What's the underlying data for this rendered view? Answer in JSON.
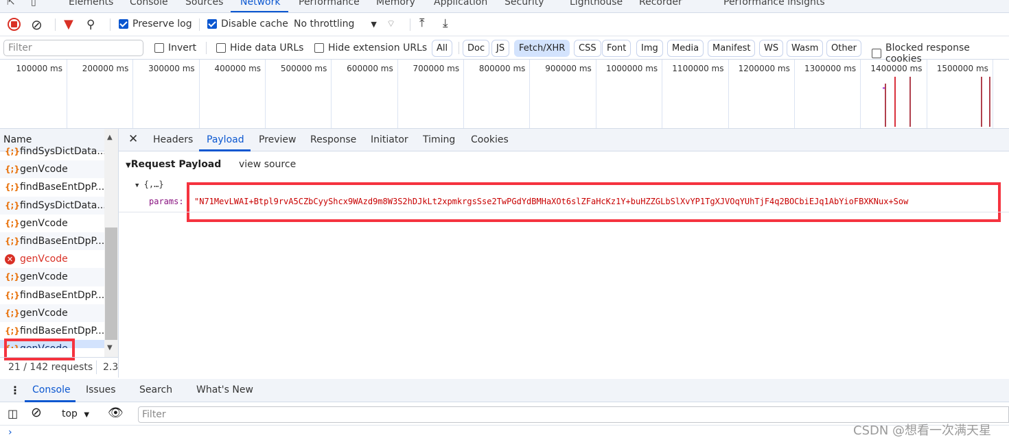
{
  "top_tabs": [
    "Elements",
    "Console",
    "Sources",
    "Network",
    "Performance",
    "Memory",
    "Application",
    "Security",
    "Lighthouse",
    "Recorder",
    "Performance insights"
  ],
  "active_top_tab": "Network",
  "toolbar": {
    "preserve_log": "Preserve log",
    "preserve_log_checked": true,
    "disable_cache": "Disable cache",
    "disable_cache_checked": true,
    "throttling": "No throttling"
  },
  "filter": {
    "placeholder": "Filter",
    "invert": "Invert",
    "hide_data_urls": "Hide data URLs",
    "hide_extension_urls": "Hide extension URLs",
    "types": [
      "All",
      "Doc",
      "JS",
      "Fetch/XHR",
      "CSS",
      "Font",
      "Img",
      "Media",
      "Manifest",
      "WS",
      "Wasm",
      "Other"
    ],
    "active_type": "Fetch/XHR",
    "blocked": "Blocked response cookies"
  },
  "timeline": {
    "ticks": [
      "100000 ms",
      "200000 ms",
      "300000 ms",
      "400000 ms",
      "500000 ms",
      "600000 ms",
      "700000 ms",
      "800000 ms",
      "900000 ms",
      "1000000 ms",
      "1100000 ms",
      "1200000 ms",
      "1300000 ms",
      "1400000 ms",
      "1500000 ms"
    ]
  },
  "requests": {
    "header": "Name",
    "items": [
      {
        "name": "findSysDictData...",
        "status": "ok"
      },
      {
        "name": "genVcode",
        "status": "ok"
      },
      {
        "name": "findBaseEntDpP...",
        "status": "ok"
      },
      {
        "name": "findSysDictData...",
        "status": "ok"
      },
      {
        "name": "genVcode",
        "status": "ok"
      },
      {
        "name": "findBaseEntDpP...",
        "status": "ok"
      },
      {
        "name": "genVcode",
        "status": "error"
      },
      {
        "name": "genVcode",
        "status": "ok"
      },
      {
        "name": "findBaseEntDpP...",
        "status": "ok"
      },
      {
        "name": "genVcode",
        "status": "ok"
      },
      {
        "name": "findBaseEntDpP...",
        "status": "ok"
      },
      {
        "name": "genVcode",
        "status": "selected"
      }
    ],
    "summary": "21 / 142 requests",
    "transferred": "2.3"
  },
  "details": {
    "tabs": [
      "Headers",
      "Payload",
      "Preview",
      "Response",
      "Initiator",
      "Timing",
      "Cookies"
    ],
    "active_tab": "Payload",
    "section_title": "Request Payload",
    "view_source": "view source",
    "object_summary": "{,…}",
    "param_key": "params:",
    "param_value": "\"N71MevLWAI+Btpl9rvA5CZbCyyShcx9WAzd9m8W3S2hDJkLt2xpmkrgsSse2TwPGdYdBMHaXOt6slZFaHcKz1Y+buHZZGLbSlXvYP1TgXJVOqYUhTjF4q2BOCbiEJq1AbYioFBXKNux+Sow"
  },
  "drawer": {
    "tabs": [
      "Console",
      "Issues",
      "Search",
      "What's New"
    ],
    "active_tab": "Console",
    "context": "top",
    "filter_placeholder": "Filter"
  },
  "watermark": "CSDN @想看一次满天星",
  "colors": {
    "accent": "#0b57d0",
    "highlight": "#f5333f",
    "error": "#d93025",
    "xhr_icon": "#e8710a",
    "string_value": "#c80000"
  }
}
